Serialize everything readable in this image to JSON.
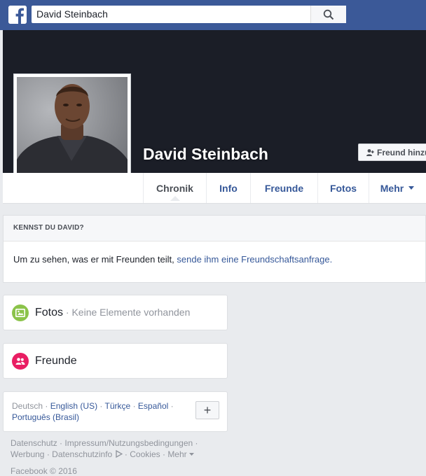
{
  "topbar": {
    "search_value": "David Steinbach"
  },
  "profile": {
    "name": "David Steinbach",
    "add_friend_label": "Freund hinzu"
  },
  "nav": {
    "tabs": [
      "Chronik",
      "Info",
      "Freunde",
      "Fotos",
      "Mehr"
    ]
  },
  "know": {
    "heading": "KENNST DU DAVID?",
    "text": "Um zu sehen, was er mit Freunden teilt, ",
    "link": "sende ihm eine Freundschaftsanfrage."
  },
  "photos": {
    "title": "Fotos",
    "sep": " · ",
    "subtitle": "Keine Elemente vorhanden"
  },
  "friends": {
    "title": "Freunde"
  },
  "languages": {
    "current": "Deutsch",
    "items": [
      "English (US)",
      "Türkçe",
      "Español",
      "Português (Brasil)"
    ],
    "more_button": "+"
  },
  "footer": {
    "links_row1": [
      "Datenschutz",
      "Impressum/Nutzungsbedingungen"
    ],
    "links_row2": [
      "Werbung",
      "Datenschutzinfo",
      "Cookies",
      "Mehr"
    ],
    "copyright": "Facebook © 2016"
  },
  "colors": {
    "brand": "#3b5998",
    "link": "#365899",
    "photos_icon": "#8bc34a",
    "friends_icon": "#e91e63"
  },
  "icons": {
    "logo": "facebook-f-icon",
    "search": "search-icon",
    "add_friend": "add-person-icon",
    "dropdown": "caret-down-icon",
    "photos": "photo-icon",
    "friends": "people-icon",
    "adchoices": "adchoices-icon"
  }
}
